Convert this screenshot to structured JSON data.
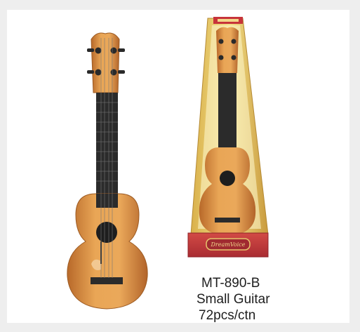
{
  "product": {
    "model": "MT-890-B",
    "name": "Small Guitar",
    "packing": "72pcs/ctn",
    "box_brand": "DreamVoice"
  },
  "colors": {
    "background": "#ffffff",
    "wood_light": "#e8a24f",
    "wood_dark": "#b96c27",
    "fretboard": "#2b2b2b",
    "box_gold": "#e9c85a",
    "box_red": "#c7343a"
  }
}
